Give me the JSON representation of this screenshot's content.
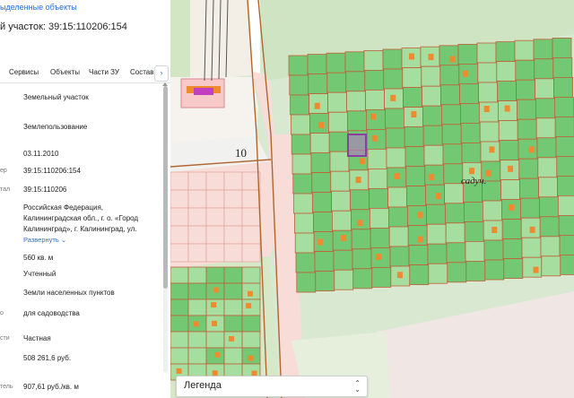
{
  "panel": {
    "top_link": "ыделенные объекты",
    "parcel_title": "й участок: 39:15:110206:154",
    "tabs": [
      "Сервисы",
      "Объекты",
      "Части ЗУ",
      "Состав"
    ],
    "tab_more": "›",
    "rows": [
      {
        "label": "",
        "value": "Земельный участок"
      },
      {
        "label": "",
        "value": "Землепользование"
      },
      {
        "label": "",
        "value": "03.11.2010"
      },
      {
        "label": "ер",
        "value": "39:15:110206:154"
      },
      {
        "label": "тал",
        "value": "39:15:110206"
      },
      {
        "label": "",
        "value": "Российская Федерация,\nКалининградская обл., г. о. «Город\nКалининград», г. Калининград, ул."
      },
      {
        "label": "",
        "value": "560 кв. м"
      },
      {
        "label": "",
        "value": "Учтенный"
      },
      {
        "label": "",
        "value": "Земли населенных пунктов"
      },
      {
        "label": "о",
        "value": "для садоводства"
      },
      {
        "label": "сти",
        "value": "Частная"
      },
      {
        "label": "",
        "value": "508 261,6 руб."
      },
      {
        "label": "тель",
        "value": "907,61 руб./кв. м"
      }
    ],
    "expand_link": "Развернуть ⌄"
  },
  "map": {
    "labels": {
      "road_number": "10",
      "area_name": "садуч."
    },
    "legend": {
      "label": "Легенда",
      "caret": "⌃\n⌄"
    },
    "colors": {
      "parcel_green": "#73c973",
      "parcel_light": "#a6dea0",
      "boundary": "#c0603a",
      "building": "#f08a2e",
      "selected": "#8b3fa0",
      "road_pink": "#f7dcd8"
    }
  }
}
